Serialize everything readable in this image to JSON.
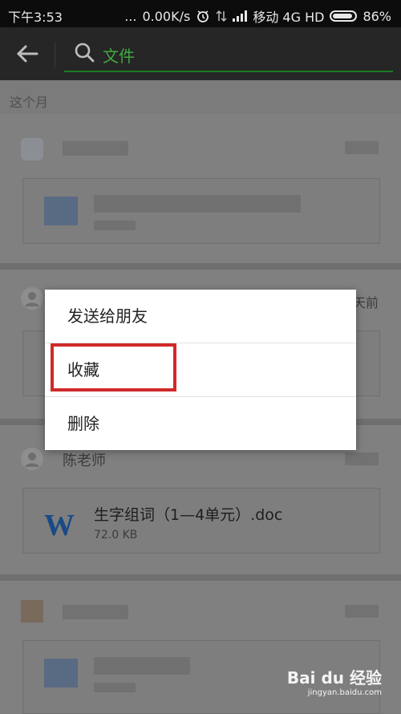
{
  "status_bar": {
    "time": "下午3:53",
    "dots": "...",
    "speed": "0.00K/s",
    "carrier": "移动 4G HD",
    "battery": "86%"
  },
  "toolbar": {
    "search_value": "文件"
  },
  "content": {
    "section_label": "这个月",
    "partial_time": "天前",
    "card3": {
      "sender": "陈老师",
      "file_name": "生字组词（1—4单元）.doc",
      "file_size": "72.0 KB"
    }
  },
  "dialog": {
    "items": [
      "发送给朋友",
      "收藏",
      "删除"
    ]
  },
  "watermark": {
    "brand": "Bai du 经验",
    "url": "jingyan.baidu.com"
  },
  "colors": {
    "accent_green": "#1d7b23",
    "highlight_red": "#d02a2a",
    "word_blue": "#1a4a86"
  }
}
